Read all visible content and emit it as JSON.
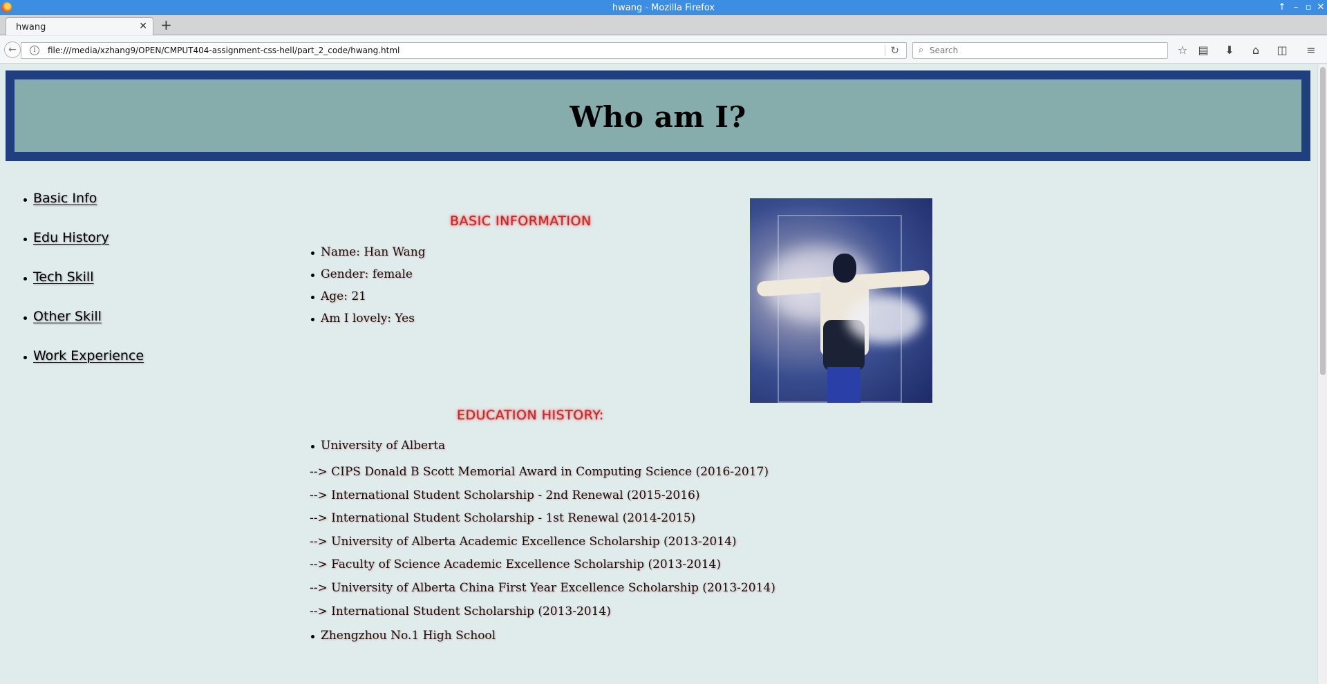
{
  "window": {
    "title": "hwang - Mozilla Firefox"
  },
  "tab": {
    "label": "hwang"
  },
  "navbar": {
    "url": "file:///media/xzhang9/OPEN/CMPUT404-assignment-css-hell/part_2_code/hwang.html",
    "search_placeholder": "Search"
  },
  "page": {
    "heading": "Who am I?",
    "nav": [
      {
        "label": "Basic Info"
      },
      {
        "label": "Edu History"
      },
      {
        "label": "Tech Skill"
      },
      {
        "label": "Other Skill"
      },
      {
        "label": "Work Experience"
      }
    ],
    "basic": {
      "title": "BASIC INFORMATION",
      "items": [
        {
          "text": "Name: Han Wang"
        },
        {
          "text": "Gender: female"
        },
        {
          "text": "Age: 21"
        },
        {
          "text": "Am I lovely: Yes"
        }
      ]
    },
    "education": {
      "title": "EDUCATION HISTORY:",
      "schools": [
        {
          "name": "University of Alberta",
          "awards": [
            "--> CIPS Donald B Scott Memorial Award in Computing Science (2016-2017)",
            "--> International Student Scholarship - 2nd Renewal (2015-2016)",
            "--> International Student Scholarship - 1st Renewal (2014-2015)",
            "--> University of Alberta Academic Excellence Scholarship (2013-2014)",
            "--> Faculty of Science Academic Excellence Scholarship (2013-2014)",
            "--> University of Alberta China First Year Excellence Scholarship (2013-2014)",
            "--> International Student Scholarship (2013-2014)"
          ]
        },
        {
          "name": "Zhengzhou No.1 High School",
          "awards": []
        }
      ]
    }
  },
  "colors": {
    "titlebar": "#3c8ee2",
    "page_background": "#e0ecec",
    "header_border": "#1f3f7e",
    "header_fill": "#86acac",
    "section_title": "#bb2a2a"
  }
}
